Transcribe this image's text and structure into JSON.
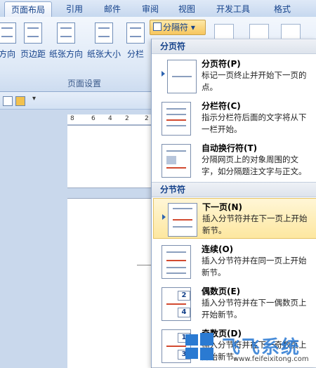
{
  "tabs": [
    "页面布局",
    "引用",
    "邮件",
    "审阅",
    "视图",
    "开发工具",
    "格式"
  ],
  "ribbon": {
    "buttons": [
      "方向",
      "页边距",
      "纸张方向",
      "纸张大小",
      "分栏"
    ],
    "group_label": "页面设置",
    "breaks_button": "分隔符",
    "breaks_icon": "breaks-icon"
  },
  "ruler_ticks": [
    "8",
    "6",
    "4",
    "2",
    "2"
  ],
  "menu": {
    "section_page": "分页符",
    "section_section": "分节符",
    "items": [
      {
        "title": "分页符(P)",
        "desc": "标记一页终止并开始下一页的点。",
        "icon": "page-break-icon"
      },
      {
        "title": "分栏符(C)",
        "desc": "指示分栏符后面的文字将从下一栏开始。",
        "icon": "column-break-icon"
      },
      {
        "title": "自动换行符(T)",
        "desc": "分隔网页上的对象周围的文字，如分隔题注文字与正文。",
        "icon": "text-wrapping-icon"
      },
      {
        "title": "下一页(N)",
        "desc": "插入分节符并在下一页上开始新节。",
        "icon": "next-page-icon"
      },
      {
        "title": "连续(O)",
        "desc": "插入分节符并在同一页上开始新节。",
        "icon": "continuous-icon"
      },
      {
        "title": "偶数页(E)",
        "desc": "插入分节符并在下一偶数页上开始新节。",
        "icon": "even-page-icon"
      },
      {
        "title": "奇数页(D)",
        "desc": "插入分节符并在下一奇数页上开始新节。",
        "icon": "odd-page-icon"
      }
    ]
  },
  "watermark": {
    "brand": "飞飞系统",
    "url": "www.feifeixitong.com"
  },
  "colors": {
    "accent": "#15428b",
    "highlight": "#fde7a0",
    "section_break_red": "#d24a30"
  }
}
